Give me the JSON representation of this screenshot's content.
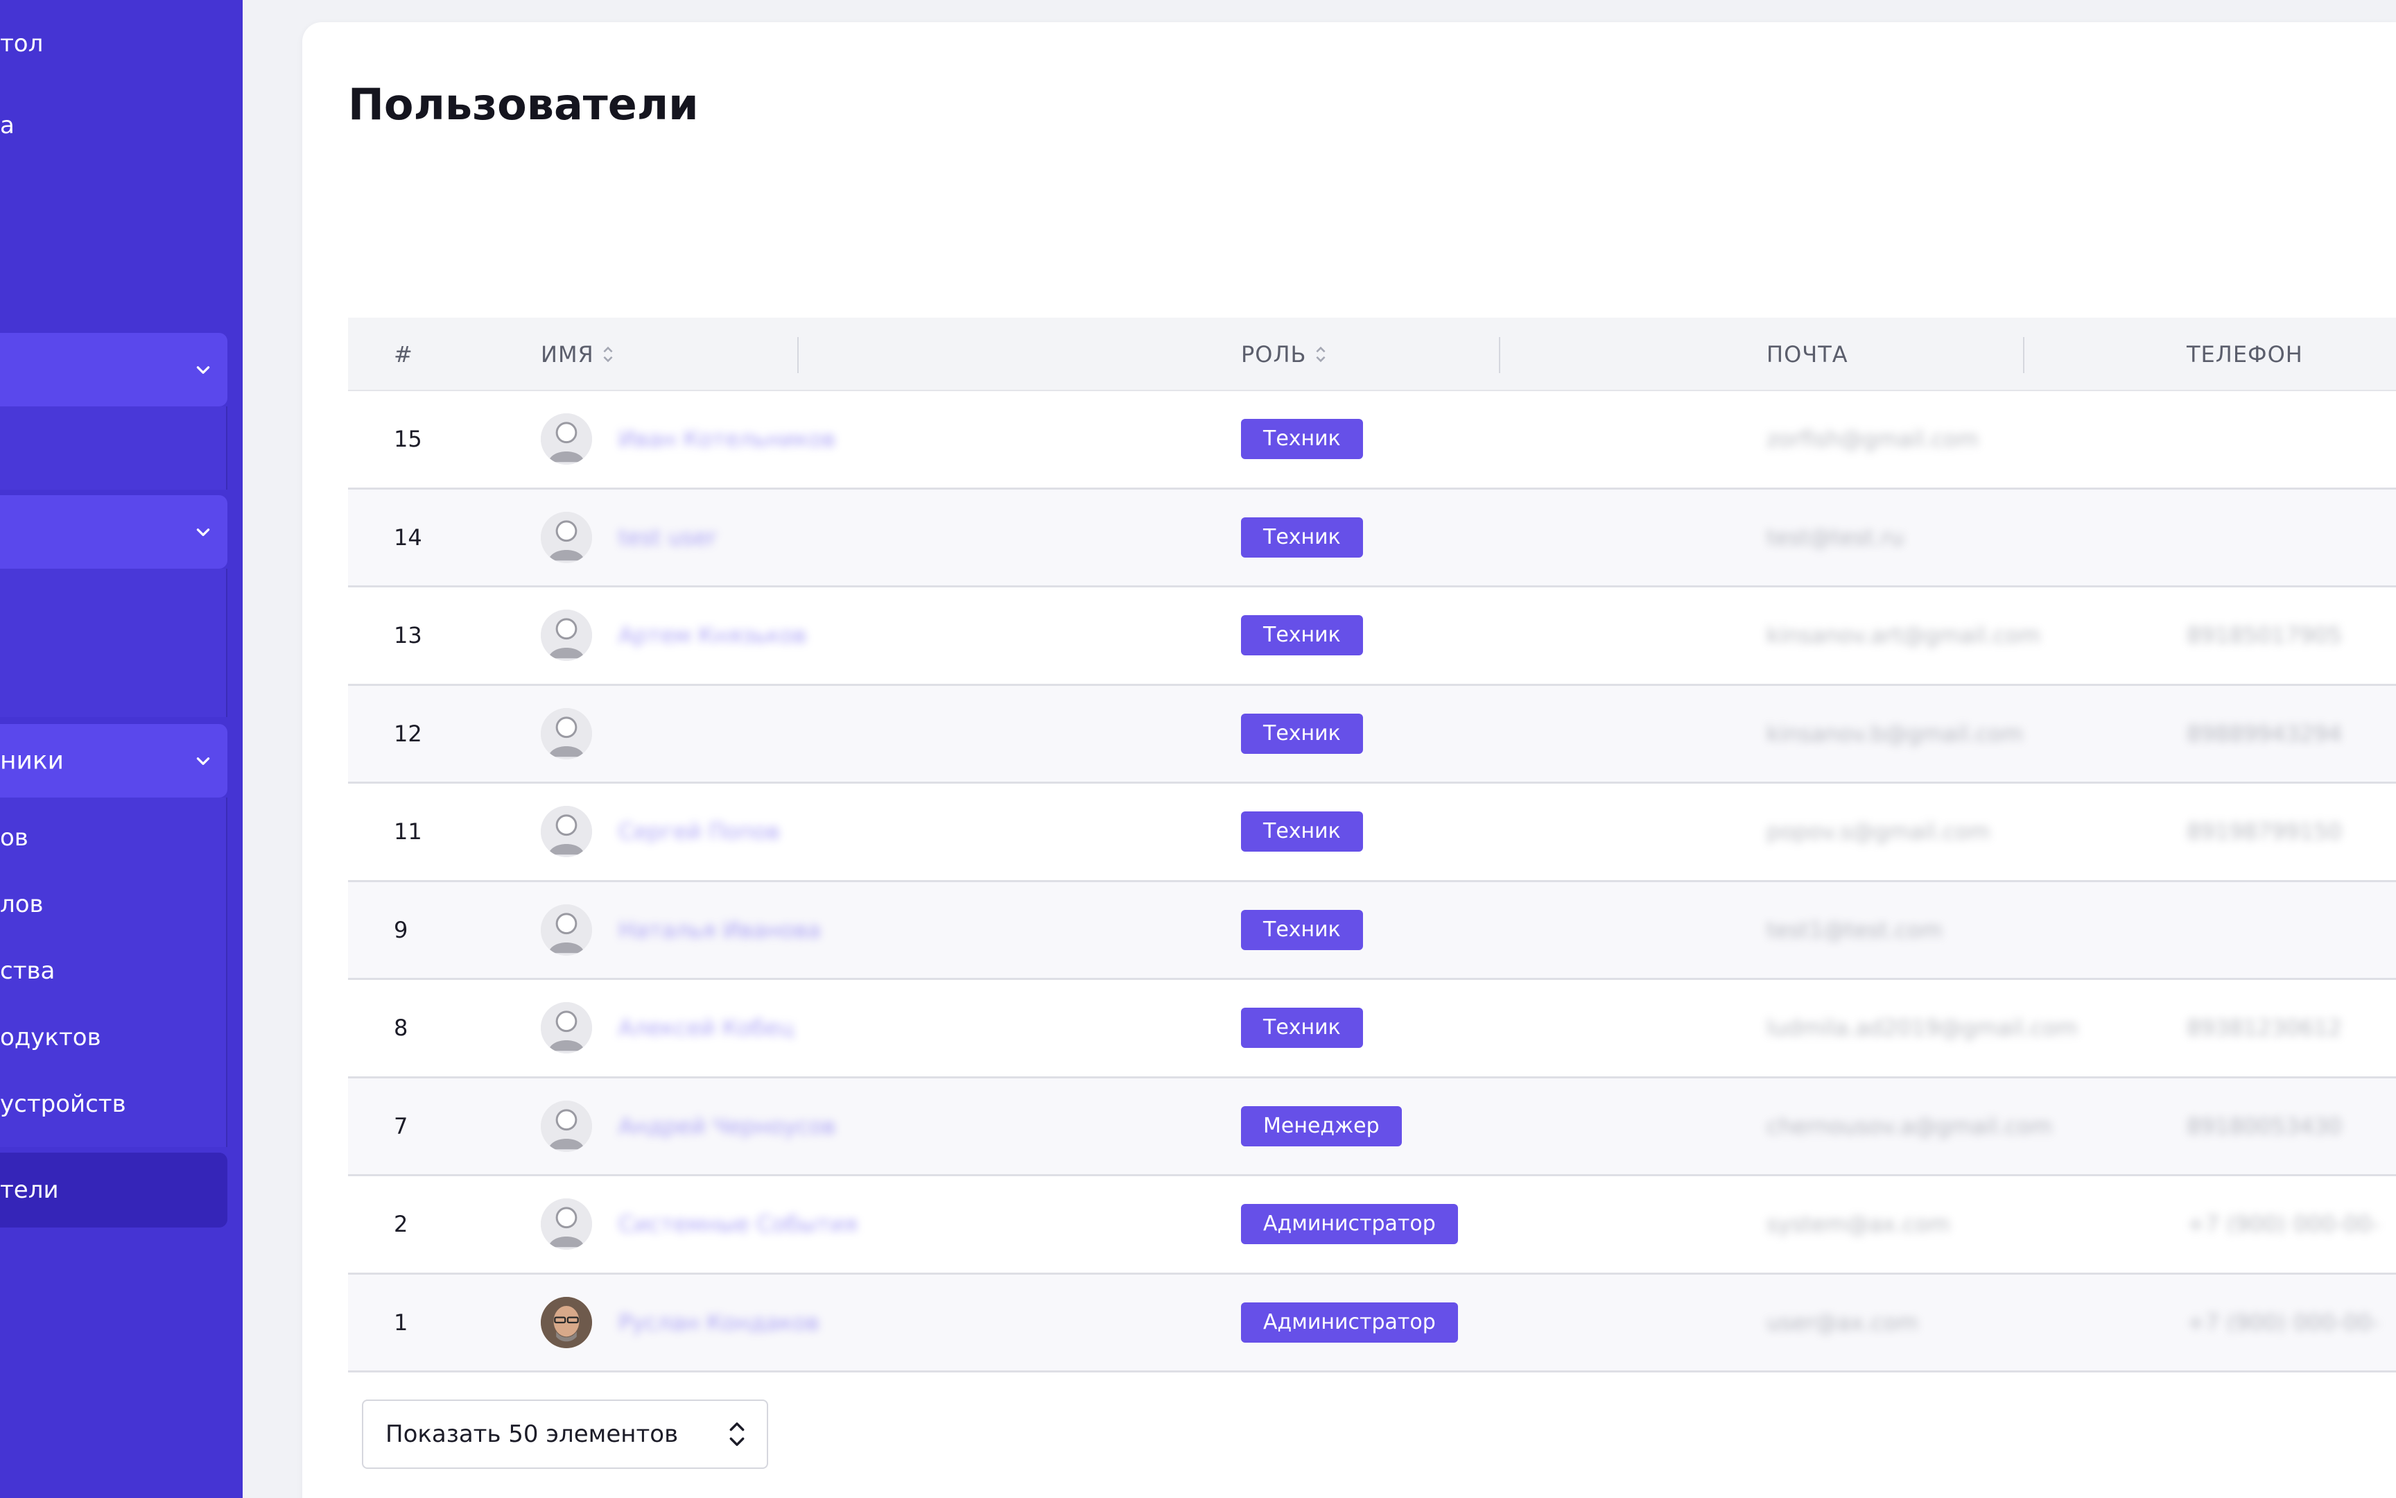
{
  "sidebar": {
    "items": [
      {
        "label": "тол"
      },
      {
        "label": "а"
      }
    ],
    "group1": {
      "label": ""
    },
    "group2": {
      "label": ""
    },
    "group3": {
      "label": "ники"
    },
    "sub_items": [
      {
        "label": "ов"
      },
      {
        "label": "лов"
      },
      {
        "label": "ства"
      },
      {
        "label": "одуктов"
      },
      {
        "label": "устройств"
      }
    ],
    "active_item": {
      "label": "тели"
    }
  },
  "page": {
    "title": "Пользователи"
  },
  "table": {
    "headers": {
      "id": "#",
      "name": "ИМЯ",
      "role": "РОЛЬ",
      "email": "ПОЧТА",
      "phone": "ТЕЛЕФОН"
    },
    "rows": [
      {
        "id": "15",
        "name": "Иван Котельников",
        "role": "Техник",
        "email": "zorfish@gmail.com",
        "phone": ""
      },
      {
        "id": "14",
        "name": "test user",
        "role": "Техник",
        "email": "test@test.ru",
        "phone": ""
      },
      {
        "id": "13",
        "name": "Артем Князьков",
        "role": "Техник",
        "email": "kinsanov.art@gmail.com",
        "phone": "89185017905"
      },
      {
        "id": "12",
        "name": "",
        "role": "Техник",
        "email": "kinsanov.b@gmail.com",
        "phone": "89889943294"
      },
      {
        "id": "11",
        "name": "Сергей Попов",
        "role": "Техник",
        "email": "popov.s@gmail.com",
        "phone": "89198799150"
      },
      {
        "id": "9",
        "name": "Наталья Иванова",
        "role": "Техник",
        "email": "test1@test.com",
        "phone": ""
      },
      {
        "id": "8",
        "name": "Алексей Кобец",
        "role": "Техник",
        "email": "ludmila.ad2019@gmail.com",
        "phone": "89381230612"
      },
      {
        "id": "7",
        "name": "Андрей Черноусов",
        "role": "Менеджер",
        "email": "chernousov.a@gmail.com",
        "phone": "89180053430"
      },
      {
        "id": "2",
        "name": "Системные События",
        "role": "Администратор",
        "email": "system@ax.com",
        "phone": "+7 (900) 000-00-"
      },
      {
        "id": "1",
        "name": "Руслан Кондаков",
        "role": "Администратор",
        "email": "user@ax.com",
        "phone": "+7 (900) 000-00-"
      }
    ]
  },
  "pagination": {
    "page_size_label": "Показать 50 элементов"
  },
  "colors": {
    "sidebar_bg": "#4534d3",
    "badge_bg": "#6650e8",
    "page_bg": "#f1f2f6"
  }
}
